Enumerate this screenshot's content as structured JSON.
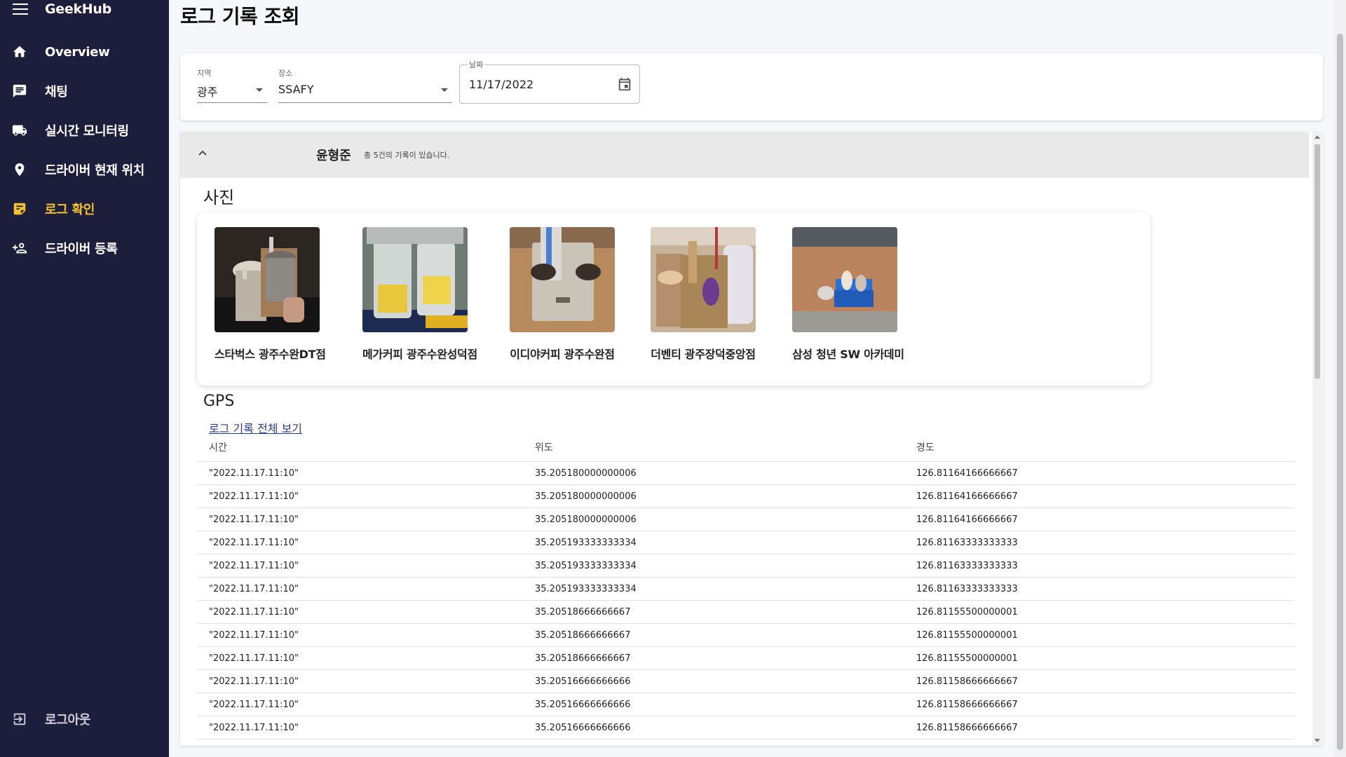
{
  "app": {
    "brand": "GeekHub"
  },
  "sidebar": {
    "items": [
      {
        "label": "Overview",
        "icon": "home-icon"
      },
      {
        "label": "채팅",
        "icon": "chat-icon"
      },
      {
        "label": "실시간 모니터링",
        "icon": "truck-icon"
      },
      {
        "label": "드라이버 현재 위치",
        "icon": "location-pin-icon"
      },
      {
        "label": "로그 확인",
        "icon": "log-note-icon",
        "active": true
      },
      {
        "label": "드라이버 등록",
        "icon": "person-add-icon"
      }
    ],
    "logout_label": "로그아웃",
    "active_color": "#f4c22b",
    "bg_color": "#1c1e3c"
  },
  "page": {
    "title": "로그 기록 조회"
  },
  "filters": {
    "region": {
      "caption": "지역",
      "value": "광주"
    },
    "place": {
      "caption": "장소",
      "value": "SSAFY"
    },
    "date": {
      "caption": "날짜",
      "value": "11/17/2022"
    }
  },
  "accordion": {
    "name": "윤형준",
    "count_text": "총 5건의 기록이 있습니다."
  },
  "photos": {
    "title": "사진",
    "items": [
      {
        "caption": "스타벅스 광주수완DT점"
      },
      {
        "caption": "메가커피 광주수완성덕점"
      },
      {
        "caption": "이디야커피 광주수완점"
      },
      {
        "caption": "더벤티 광주장덕중앙점"
      },
      {
        "caption": "삼성 청년 SW 아카데미"
      }
    ]
  },
  "gps": {
    "title": "GPS",
    "link_label": "로그 기록 전체 보기",
    "columns": [
      "시간",
      "위도",
      "경도"
    ],
    "rows": [
      [
        "\"2022.11.17.11:10\"",
        "35.205180000000006",
        "126.81164166666667"
      ],
      [
        "\"2022.11.17.11:10\"",
        "35.205180000000006",
        "126.81164166666667"
      ],
      [
        "\"2022.11.17.11:10\"",
        "35.205180000000006",
        "126.81164166666667"
      ],
      [
        "\"2022.11.17.11:10\"",
        "35.205193333333334",
        "126.81163333333333"
      ],
      [
        "\"2022.11.17.11:10\"",
        "35.205193333333334",
        "126.81163333333333"
      ],
      [
        "\"2022.11.17.11:10\"",
        "35.205193333333334",
        "126.81163333333333"
      ],
      [
        "\"2022.11.17.11:10\"",
        "35.20518666666667",
        "126.81155500000001"
      ],
      [
        "\"2022.11.17.11:10\"",
        "35.20518666666667",
        "126.81155500000001"
      ],
      [
        "\"2022.11.17.11:10\"",
        "35.20518666666667",
        "126.81155500000001"
      ],
      [
        "\"2022.11.17.11:10\"",
        "35.20516666666666",
        "126.81158666666667"
      ],
      [
        "\"2022.11.17.11:10\"",
        "35.20516666666666",
        "126.81158666666667"
      ],
      [
        "\"2022.11.17.11:10\"",
        "35.20516666666666",
        "126.81158666666667"
      ]
    ]
  }
}
